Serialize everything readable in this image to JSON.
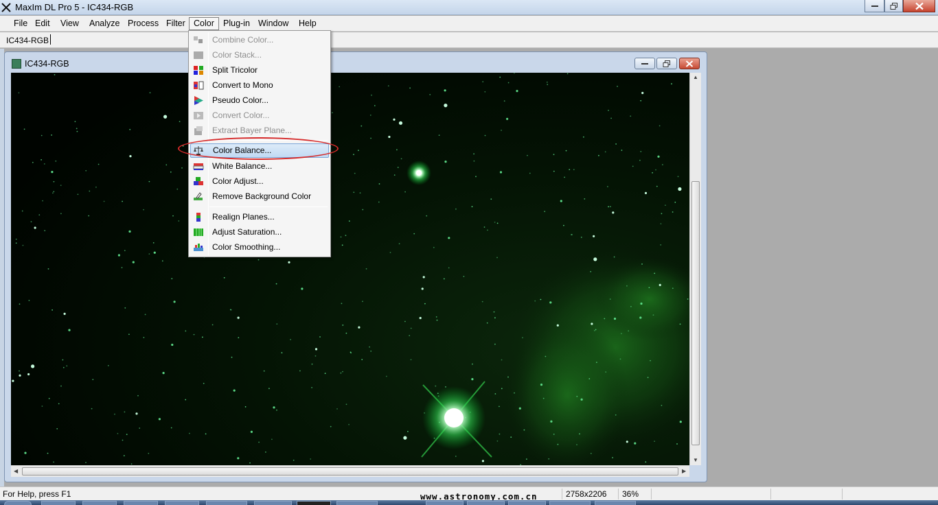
{
  "window": {
    "title": "MaxIm DL Pro 5 - IC434-RGB"
  },
  "menubar": {
    "items": [
      "File",
      "Edit",
      "View",
      "Analyze",
      "Process",
      "Filter",
      "Color",
      "Plug-in",
      "Window",
      "Help"
    ],
    "active": "Color"
  },
  "toolbar": {
    "document_selector": "IC434-RGB"
  },
  "child_window": {
    "title": "IC434-RGB"
  },
  "color_menu": {
    "items": [
      {
        "label": "Combine Color...",
        "enabled": false,
        "icon": "combine-color-icon"
      },
      {
        "label": "Color Stack...",
        "enabled": false,
        "icon": "color-stack-icon"
      },
      {
        "label": "Split Tricolor",
        "enabled": true,
        "icon": "split-tricolor-icon"
      },
      {
        "label": "Convert to Mono",
        "enabled": true,
        "icon": "convert-mono-icon"
      },
      {
        "label": "Pseudo Color...",
        "enabled": true,
        "icon": "pseudo-color-icon"
      },
      {
        "label": "Convert Color...",
        "enabled": false,
        "icon": "convert-color-icon"
      },
      {
        "label": "Extract Bayer Plane...",
        "enabled": false,
        "icon": "bayer-plane-icon"
      },
      {
        "label": "Color Balance...",
        "enabled": true,
        "icon": "balance-scale-icon",
        "highlighted": true
      },
      {
        "label": "White Balance...",
        "enabled": true,
        "icon": "white-balance-icon"
      },
      {
        "label": "Color Adjust...",
        "enabled": true,
        "icon": "color-adjust-icon"
      },
      {
        "label": "Remove Background Color",
        "enabled": true,
        "icon": "remove-background-icon"
      },
      {
        "label": "Realign Planes...",
        "enabled": true,
        "icon": "realign-planes-icon"
      },
      {
        "label": "Adjust Saturation...",
        "enabled": true,
        "icon": "saturation-icon"
      },
      {
        "label": "Color Smoothing...",
        "enabled": true,
        "icon": "smoothing-icon"
      }
    ]
  },
  "statusbar": {
    "help": "For Help, press F1",
    "dimensions": "2758x2206",
    "zoom": "36%"
  },
  "watermark": "www.astronomy.com.cn",
  "colors": {
    "highlight_ellipse": "#d52a2a",
    "menu_highlight": "#c1daf4",
    "nebula": "#1f7a1f"
  }
}
